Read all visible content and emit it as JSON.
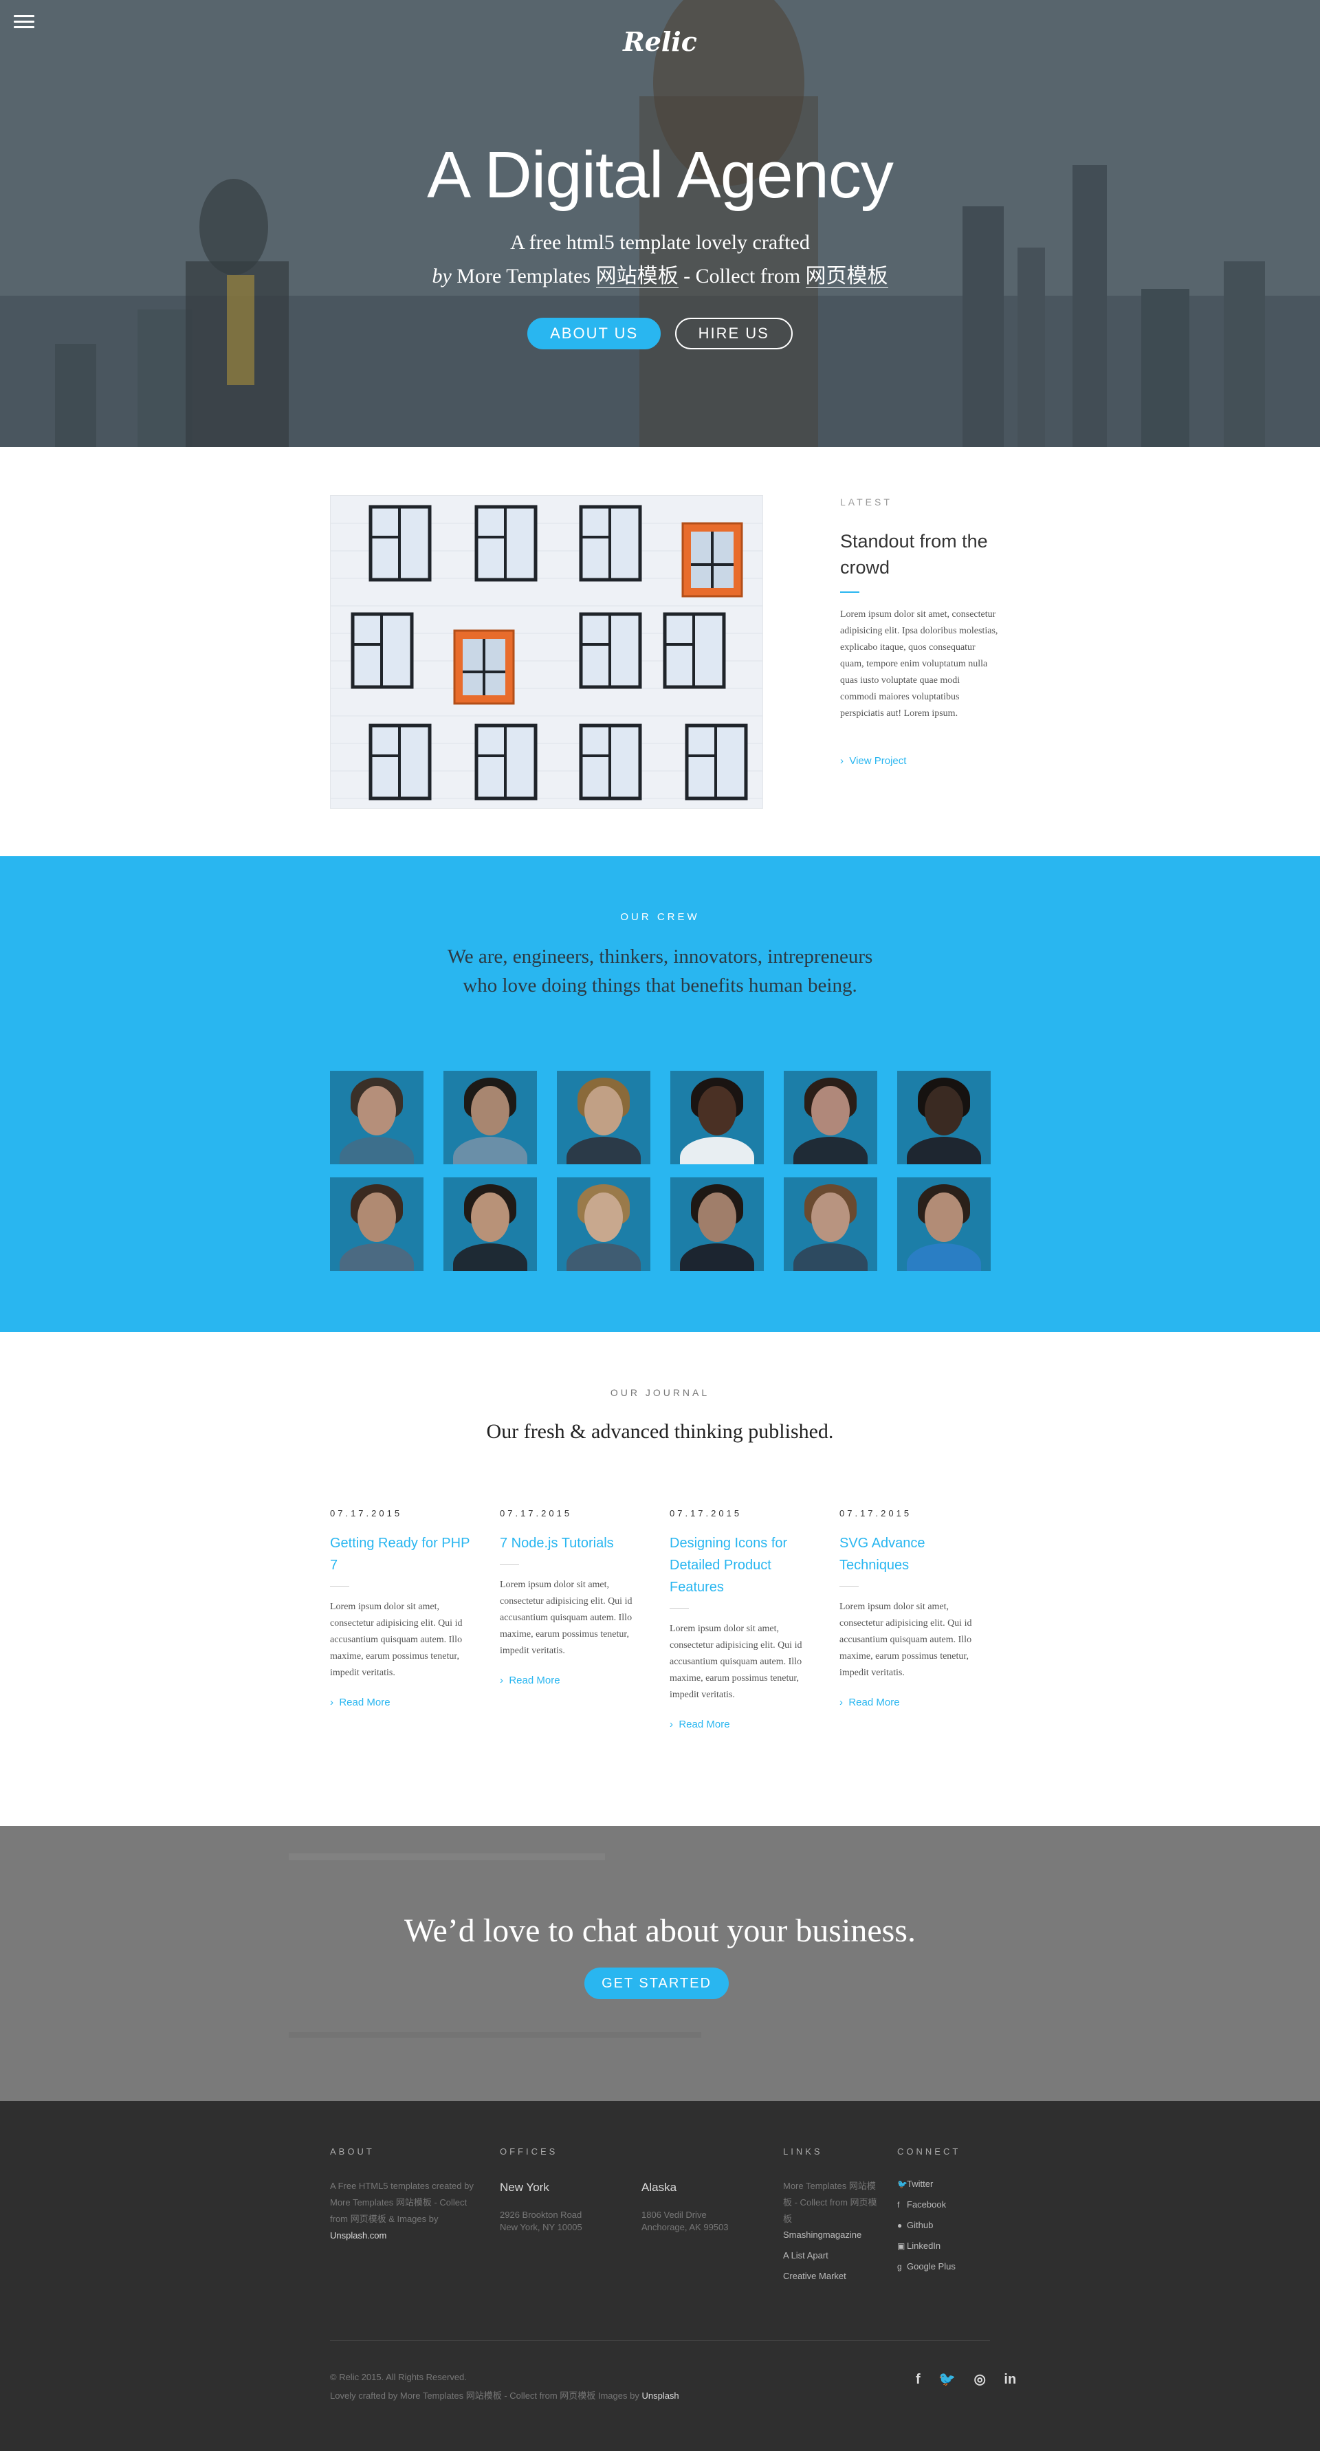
{
  "hero": {
    "logo": "Relic",
    "title": "A Digital Agency",
    "subtitle_line1": "A free html5 template lovely crafted",
    "subtitle_by": "by",
    "subtitle_part1": " More Templates ",
    "subtitle_link1": "网站模板",
    "subtitle_part2": " - Collect from ",
    "subtitle_link2": "网页模板",
    "btn_about": "ABOUT US",
    "btn_hire": "HIRE US"
  },
  "latest": {
    "label": "LATEST",
    "title": "Standout from the crowd",
    "body": "Lorem ipsum dolor sit amet, consectetur adipisicing elit. Ipsa doloribus molestias, explicabo itaque, quos consequatur quam, tempore enim voluptatum nulla quas iusto voluptate quae modi commodi maiores voluptatibus perspiciatis aut! Lorem ipsum.",
    "link": "View Project"
  },
  "crew": {
    "label": "OUR CREW",
    "text_line1": "We are, engineers, thinkers, innovators, intrepreneurs",
    "text_line2": "who love doing things that benefits human being."
  },
  "journal": {
    "label": "OUR JOURNAL",
    "title": "Our fresh & advanced thinking published.",
    "posts": [
      {
        "date": "07.17.2015",
        "title": "Getting Ready for PHP 7",
        "body": "Lorem ipsum dolor sit amet, consectetur adipisicing elit. Qui id accusantium quisquam autem. Illo maxime, earum possimus tenetur, impedit veritatis.",
        "more": "Read More"
      },
      {
        "date": "07.17.2015",
        "title": "7 Node.js Tutorials",
        "body": "Lorem ipsum dolor sit amet, consectetur adipisicing elit. Qui id accusantium quisquam autem. Illo maxime, earum possimus tenetur, impedit veritatis.",
        "more": "Read More"
      },
      {
        "date": "07.17.2015",
        "title": "Designing Icons for Detailed Product Features",
        "body": "Lorem ipsum dolor sit amet, consectetur adipisicing elit. Qui id accusantium quisquam autem. Illo maxime, earum possimus tenetur, impedit veritatis.",
        "more": "Read More"
      },
      {
        "date": "07.17.2015",
        "title": "SVG Advance Techniques",
        "body": "Lorem ipsum dolor sit amet, consectetur adipisicing elit. Qui id accusantium quisquam autem. Illo maxime, earum possimus tenetur, impedit veritatis.",
        "more": "Read More"
      }
    ]
  },
  "cta": {
    "text": "We’d love to chat about your business.",
    "button": "GET STARTED"
  },
  "footer": {
    "about_head": "ABOUT",
    "about_text": "A Free HTML5 templates created by More Templates 网站模板 - Collect from 网页模板 & Images by",
    "about_link": "Unsplash.com",
    "offices_head": "OFFICES",
    "office1_city": "New York",
    "office1_addr1": "2926 Brookton Road",
    "office1_addr2": "New York, NY 10005",
    "office2_city": "Alaska",
    "office2_addr1": "1806 Vedil Drive",
    "office2_addr2": "Anchorage, AK 99503",
    "links_head": "LINKS",
    "links_text": "More Templates 网站模板 - Collect from 网页模板",
    "links": [
      "Smashingmagazine",
      "A List Apart",
      "Creative Market"
    ],
    "connect_head": "CONNECT",
    "social": [
      "Twitter",
      "Facebook",
      "Github",
      "LinkedIn",
      "Google Plus"
    ],
    "copyright": "© Relic 2015. All Rights Reserved.",
    "credit": "Lovely crafted by More Templates 网站模板 - Collect from 网页模板 Images by",
    "credit_link": "Unsplash",
    "accent": "#29b6f0"
  }
}
